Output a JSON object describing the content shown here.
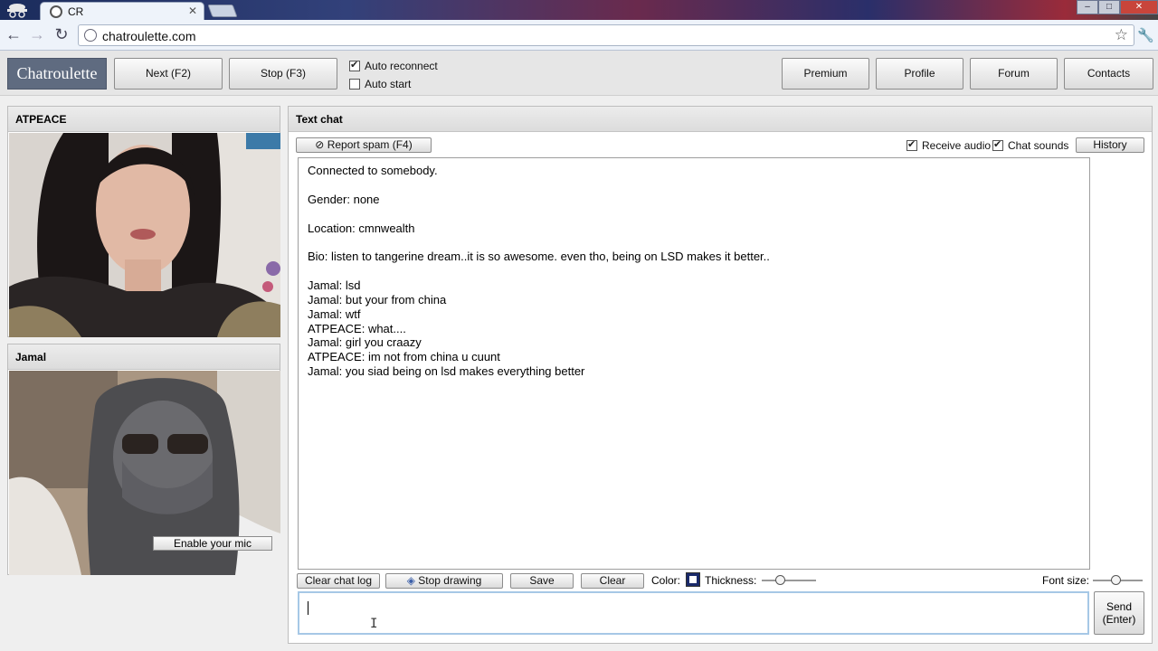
{
  "browser": {
    "tab_title": "CR",
    "tab_close": "✕",
    "url": "chatroulette.com",
    "win_min": "–",
    "win_max": "□",
    "win_close": "✕"
  },
  "header": {
    "logo": "Chatroulette",
    "next_label": "Next (F2)",
    "stop_label": "Stop (F3)",
    "auto_reconnect_label": "Auto reconnect",
    "auto_reconnect_checked": true,
    "auto_start_label": "Auto start",
    "auto_start_checked": false,
    "premium_label": "Premium",
    "profile_label": "Profile",
    "forum_label": "Forum",
    "contacts_label": "Contacts"
  },
  "partner_video": {
    "name": "ATPEACE"
  },
  "self_video": {
    "name": "Jamal",
    "mic_button": "Enable your mic"
  },
  "text_chat": {
    "title": "Text chat",
    "report_spam": "Report spam (F4)",
    "receive_audio_label": "Receive audio",
    "receive_audio_checked": true,
    "chat_sounds_label": "Chat sounds",
    "chat_sounds_checked": true,
    "history_label": "History",
    "system_lines": [
      "Connected to somebody.",
      "Gender: none",
      "Location: cmnwealth",
      "Bio: listen to tangerine dream..it is so awesome. even tho, being on LSD makes it better.."
    ],
    "messages": [
      "Jamal: lsd",
      "Jamal: but your from china",
      "Jamal: wtf",
      "ATPEACE: what....",
      "Jamal: girl you craazy",
      "ATPEACE: im not from china u cuunt",
      "Jamal: you siad being on lsd makes everything better"
    ],
    "clear_log_label": "Clear chat log",
    "stop_drawing_label": "Stop drawing",
    "save_label": "Save",
    "clear_label": "Clear",
    "color_label": "Color:",
    "thickness_label": "Thickness:",
    "font_size_label": "Font size:",
    "thickness_value": 0.3,
    "font_size_value": 0.45,
    "send_label": "Send",
    "send_hint": "(Enter)",
    "input_value": ""
  }
}
